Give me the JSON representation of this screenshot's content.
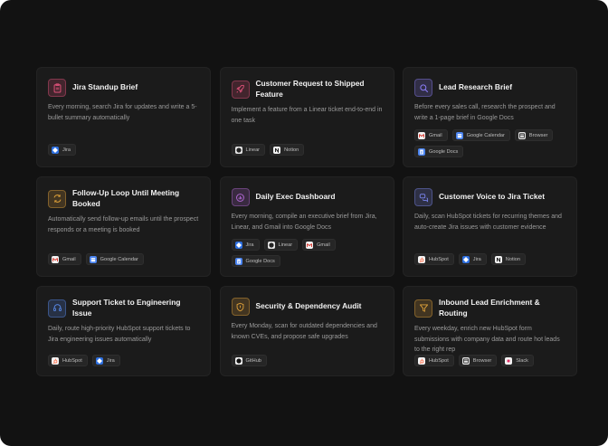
{
  "cards": [
    {
      "title": "Jira Standup Brief",
      "desc": "Every morning, search Jira for updates and write a 5-bullet summary automatically",
      "icon": "clipboard-icon",
      "accent": "#e0527a",
      "chips": [
        {
          "label": "Jira",
          "icon": "jira-icon"
        }
      ]
    },
    {
      "title": "Customer Request to Shipped Feature",
      "desc": "Implement a feature from a Linear ticket end-to-end in one task",
      "icon": "rocket-icon",
      "accent": "#e0527a",
      "chips": [
        {
          "label": "Linear",
          "icon": "linear-icon"
        },
        {
          "label": "Notion",
          "icon": "notion-icon"
        }
      ]
    },
    {
      "title": "Lead Research Brief",
      "desc": "Before every sales call, research the prospect and write a 1-page brief in Google Docs",
      "icon": "search-icon",
      "accent": "#8b7cf6",
      "chips": [
        {
          "label": "Gmail",
          "icon": "gmail-icon"
        },
        {
          "label": "Google Calendar",
          "icon": "calendar-icon"
        },
        {
          "label": "Browser",
          "icon": "browser-icon"
        },
        {
          "label": "Google Docs",
          "icon": "docs-icon"
        }
      ]
    },
    {
      "title": "Follow-Up Loop Until Meeting Booked",
      "desc": "Automatically send follow-up emails until the prospect responds or a meeting is booked",
      "icon": "refresh-icon",
      "accent": "#e0a23a",
      "chips": [
        {
          "label": "Gmail",
          "icon": "gmail-icon"
        },
        {
          "label": "Google Calendar",
          "icon": "calendar-icon"
        }
      ]
    },
    {
      "title": "Daily Exec Dashboard",
      "desc": "Every morning, compile an executive brief from Jira, Linear, and Gmail into Google Docs",
      "icon": "dashboard-icon",
      "accent": "#b46ad8",
      "chips": [
        {
          "label": "Jira",
          "icon": "jira-icon"
        },
        {
          "label": "Linear",
          "icon": "linear-icon"
        },
        {
          "label": "Gmail",
          "icon": "gmail-icon"
        },
        {
          "label": "Google Docs",
          "icon": "docs-icon"
        }
      ]
    },
    {
      "title": "Customer Voice to Jira Ticket",
      "desc": "Daily, scan HubSpot tickets for recurring themes and auto-create Jira issues with customer evidence",
      "icon": "chat-icon",
      "accent": "#7b86f0",
      "chips": [
        {
          "label": "HubSpot",
          "icon": "hubspot-icon"
        },
        {
          "label": "Jira",
          "icon": "jira-icon"
        },
        {
          "label": "Notion",
          "icon": "notion-icon"
        }
      ]
    },
    {
      "title": "Support Ticket to Engineering Issue",
      "desc": "Daily, route high-priority HubSpot support tickets to Jira engineering issues automatically",
      "icon": "headset-icon",
      "accent": "#5b8def",
      "chips": [
        {
          "label": "HubSpot",
          "icon": "hubspot-icon"
        },
        {
          "label": "Jira",
          "icon": "jira-icon"
        }
      ]
    },
    {
      "title": "Security & Dependency Audit",
      "desc": "Every Monday, scan for outdated dependencies and known CVEs, and propose safe upgrades",
      "icon": "shield-icon",
      "accent": "#e0a23a",
      "chips": [
        {
          "label": "GitHub",
          "icon": "github-icon"
        }
      ]
    },
    {
      "title": "Inbound Lead Enrichment & Routing",
      "desc": "Every weekday, enrich new HubSpot form submissions with company data and route hot leads to the right rep",
      "icon": "filter-icon",
      "accent": "#e0a23a",
      "chips": [
        {
          "label": "HubSpot",
          "icon": "hubspot-icon"
        },
        {
          "label": "Browser",
          "icon": "browser-icon"
        },
        {
          "label": "Slack",
          "icon": "slack-icon"
        }
      ]
    }
  ]
}
